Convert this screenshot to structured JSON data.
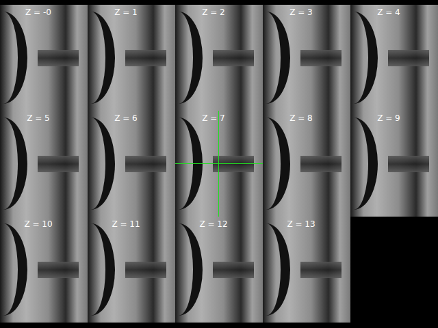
{
  "viewer": {
    "slices": [
      {
        "label": "Z = -0",
        "selected": false
      },
      {
        "label": "Z = 1",
        "selected": false
      },
      {
        "label": "Z = 2",
        "selected": false
      },
      {
        "label": "Z = 3",
        "selected": false
      },
      {
        "label": "Z = 4",
        "selected": false
      },
      {
        "label": "Z = 5",
        "selected": false
      },
      {
        "label": "Z = 6",
        "selected": false
      },
      {
        "label": "Z = 7",
        "selected": true
      },
      {
        "label": "Z = 8",
        "selected": false
      },
      {
        "label": "Z = 9",
        "selected": false
      },
      {
        "label": "Z = 10",
        "selected": false
      },
      {
        "label": "Z = 11",
        "selected": false
      },
      {
        "label": "Z = 12",
        "selected": false
      },
      {
        "label": "Z = 13",
        "selected": false
      }
    ]
  }
}
